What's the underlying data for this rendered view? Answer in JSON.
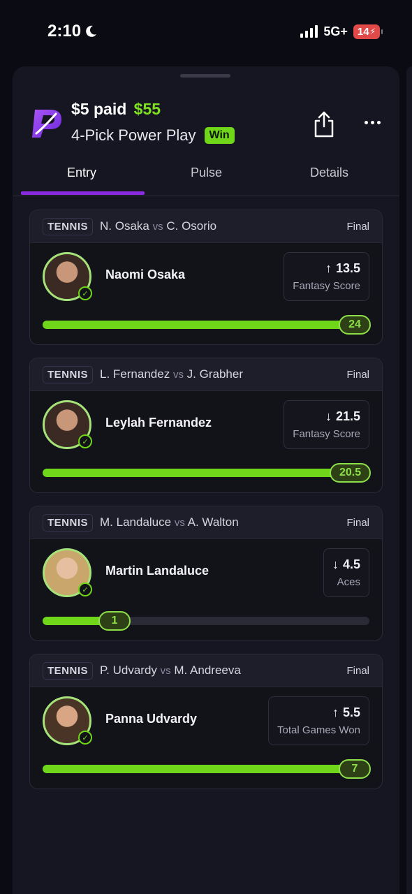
{
  "status_bar": {
    "time": "2:10",
    "network": "5G+",
    "battery": "14"
  },
  "header": {
    "paid": "$5 paid",
    "payout": "$55",
    "title": "4-Pick Power Play",
    "result_badge": "Win"
  },
  "tabs": [
    {
      "label": "Entry",
      "active": true
    },
    {
      "label": "Pulse",
      "active": false
    },
    {
      "label": "Details",
      "active": false
    }
  ],
  "picks": [
    {
      "sport": "TENNIS",
      "player_a": "N. Osaka",
      "player_b": "C. Osorio",
      "vs": "vs",
      "status": "Final",
      "player": "Naomi Osaka",
      "direction": "up",
      "line": "13.5",
      "stat": "Fantasy Score",
      "result": "24",
      "progress": 1.0
    },
    {
      "sport": "TENNIS",
      "player_a": "L. Fernandez",
      "player_b": "J. Grabher",
      "vs": "vs",
      "status": "Final",
      "player": "Leylah Fernandez",
      "direction": "down",
      "line": "21.5",
      "stat": "Fantasy Score",
      "result": "20.5",
      "progress": 0.95
    },
    {
      "sport": "TENNIS",
      "player_a": "M. Landaluce",
      "player_b": "A. Walton",
      "vs": "vs",
      "status": "Final",
      "player": "Martin Landaluce",
      "direction": "down",
      "line": "4.5",
      "stat": "Aces",
      "result": "1",
      "progress": 0.22
    },
    {
      "sport": "TENNIS",
      "player_a": "P. Udvardy",
      "player_b": "M. Andreeva",
      "vs": "vs",
      "status": "Final",
      "player": "Panna Udvardy",
      "direction": "up",
      "line": "5.5",
      "stat": "Total Games Won",
      "result": "7",
      "progress": 1.0
    }
  ],
  "colors": {
    "accent_green": "#6fd61a",
    "tab_indicator": "#8a2be2",
    "background": "#0b0b14"
  }
}
